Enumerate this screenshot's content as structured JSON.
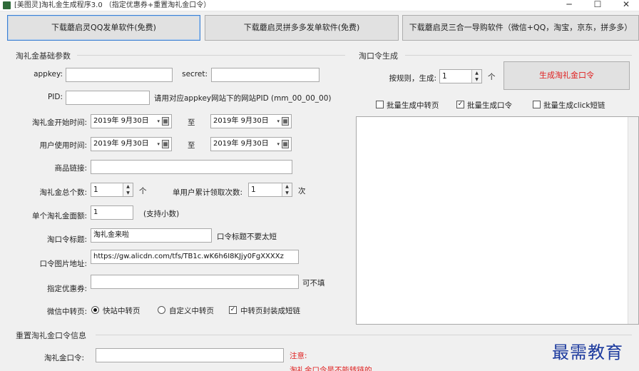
{
  "window": {
    "title": "[美图灵]淘礼金生成程序3.0 （指定优惠券+重置淘礼金口令）",
    "minimize": "─",
    "maximize": "☐",
    "close": "✕"
  },
  "top_buttons": [
    "下载蘑启灵QQ发单软件(免费)",
    "下载蘑启灵拼多多发单软件(免费)",
    "下载蘑启灵三合一导购软件（微信+QQ，淘宝，京东，拼多多）"
  ],
  "basic": {
    "section_title": "淘礼金基础参数",
    "appkey_label": "appkey:",
    "appkey_value": "",
    "secret_label": "secret:",
    "secret_value": "",
    "pid_label": "PID:",
    "pid_value": "",
    "pid_hint": "请用对应appkey网站下的网站PID (mm_00_00_00)",
    "start_label": "淘礼金开始时间:",
    "start_from": "2019年 9月30日",
    "start_to": "2019年 9月30日",
    "use_label": "用户使用时间:",
    "use_from": "2019年 9月30日",
    "use_to": "2019年 9月30日",
    "to_text": "至",
    "product_label": "商品链接:",
    "product_value": "",
    "count_label": "淘礼金总个数:",
    "count_value": "1",
    "count_unit": "个",
    "per_user_label": "单用户累计领取次数:",
    "per_user_value": "1",
    "per_user_unit": "次",
    "amount_label": "单个淘礼金面额:",
    "amount_value": "1",
    "amount_hint": "(支持小数)",
    "token_title_label": "淘口令标题:",
    "token_title_value": "淘礼金来啦",
    "token_title_hint": "口令标题不要太短",
    "image_label": "口令图片地址:",
    "image_value": "https://gw.alicdn.com/tfs/TB1c.wK6h6I8KJjy0FgXXXXz",
    "coupon_label": "指定优惠券:",
    "coupon_value": "",
    "coupon_hint": "可不填",
    "wechat_label": "微信中转页:",
    "radio_fast": "快站中转页",
    "radio_custom": "自定义中转页",
    "check_shortlink": "中转页封装成短链",
    "checkbox_mark": "✓"
  },
  "gen": {
    "section_title": "淘口令生成",
    "rule_label": "按规则，生成:",
    "rule_value": "1",
    "rule_unit": "个",
    "generate_button": "生成淘礼金口令",
    "opt_batch_transfer": "批量生成中转页",
    "opt_batch_token": "批量生成口令",
    "opt_batch_click": "批量生成click短链",
    "output_text": ""
  },
  "reset": {
    "section_title": "重置淘礼金口令信息",
    "token_label": "淘礼金口令:",
    "token_value": "",
    "notice_title": "注意:",
    "notice_text": "淘礼金口令是不能转链的"
  },
  "watermark": "最需教育",
  "colors": {
    "accent_red": "#e02020",
    "watermark_blue": "#1c3a9e",
    "focus_blue": "#3c7fd1"
  }
}
